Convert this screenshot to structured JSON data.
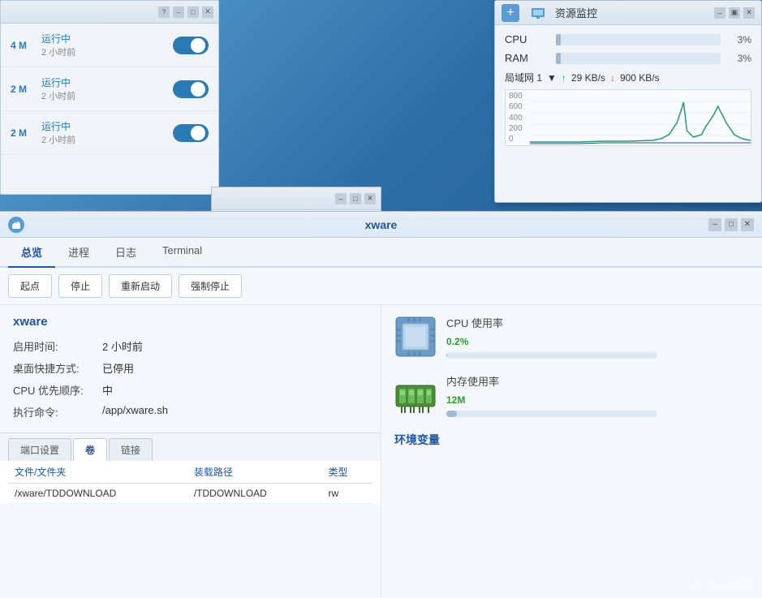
{
  "desktop": {
    "bg": "#3a7ab5"
  },
  "resource_monitor": {
    "title": "资源监控",
    "plus_label": "+",
    "cpu_label": "CPU",
    "cpu_pct": "3%",
    "cpu_fill_pct": 3,
    "ram_label": "RAM",
    "ram_pct": "3%",
    "ram_fill_pct": 3,
    "net_label": "局域网 1",
    "net_up": "29 KB/s",
    "net_down": "900 KB/s",
    "chart_labels": [
      "800",
      "600",
      "400",
      "200",
      "0"
    ],
    "wbtns": [
      "–",
      "□",
      "▣"
    ]
  },
  "topleft_window": {
    "services": [
      {
        "size": "4 M",
        "status": "运行中",
        "time": "2 小时前"
      },
      {
        "size": "2 M",
        "status": "运行中",
        "time": "2 小时前"
      },
      {
        "size": "2 M",
        "status": "运行中",
        "time": "2 小时前"
      }
    ]
  },
  "xware_window": {
    "title": "xware",
    "wbtns": [
      "–",
      "□",
      "✕"
    ],
    "tabs": [
      "总览",
      "进程",
      "日志",
      "Terminal"
    ],
    "active_tab": "总览",
    "toolbar": {
      "buttons": [
        "起点",
        "停止",
        "重新启动",
        "强制停止"
      ]
    },
    "app_info": {
      "name": "xware",
      "fields": [
        {
          "key": "启用时间:",
          "val": "2 小时前"
        },
        {
          "key": "桌面快捷方式:",
          "val": "已停用"
        },
        {
          "key": "CPU 优先顺序:",
          "val": "中"
        },
        {
          "key": "执行命令:",
          "val": "/app/xware.sh"
        }
      ]
    },
    "cpu_widget": {
      "title": "CPU 使用率",
      "value": "0.2",
      "unit": "%",
      "fill_pct": 0.2
    },
    "ram_widget": {
      "title": "内存使用率",
      "value": "12",
      "unit": "M",
      "fill_pct": 5
    },
    "bottom_tabs": [
      "端口设置",
      "卷",
      "链接"
    ],
    "active_btab": "卷",
    "file_table": {
      "headers": [
        "文件/文件夹",
        "装载路径",
        "类型"
      ],
      "rows": [
        {
          "file": "/xware/TDDOWNLOAD",
          "mount": "/TDDOWNLOAD",
          "type": "rw"
        }
      ]
    },
    "env_section": {
      "title": "环境变量"
    }
  },
  "watermark": "值 · 什么值得买"
}
